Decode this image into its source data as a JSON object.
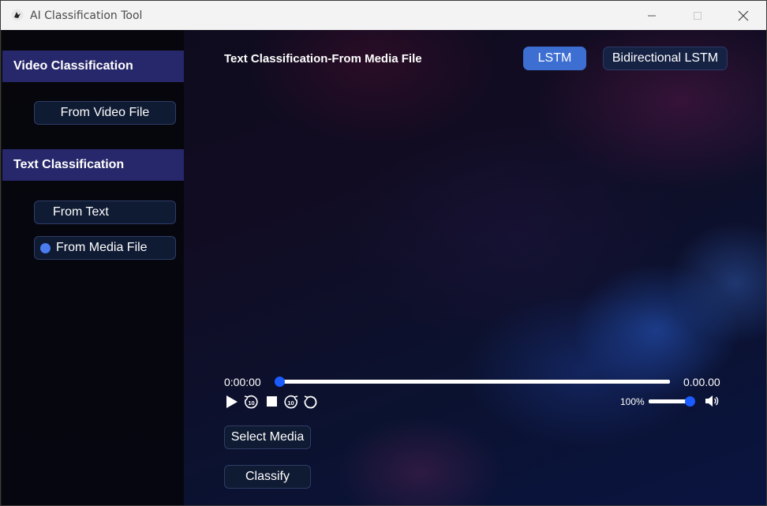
{
  "window": {
    "title": "AI Classification Tool",
    "icon": "app-bird-icon",
    "controls": [
      "minimize-icon",
      "maximize-icon",
      "close-icon"
    ]
  },
  "sidebar": {
    "video_section": {
      "header": "Video Classification",
      "items": [
        {
          "label": "From Video File",
          "selected": false
        }
      ]
    },
    "text_section": {
      "header": "Text Classification",
      "items": [
        {
          "label": "From Text",
          "selected": false
        },
        {
          "label": "From Media File",
          "selected": true
        }
      ]
    }
  },
  "main": {
    "title": "Text Classification-From Media File",
    "model_options": [
      {
        "label": "LSTM",
        "active": true
      },
      {
        "label": "Bidirectional LSTM",
        "active": false
      }
    ]
  },
  "player": {
    "time_current": "0:00:00",
    "time_total": "0.00.00",
    "progress": 0,
    "controls": [
      "play-icon",
      "rewind-10-icon",
      "stop-icon",
      "forward-10-icon",
      "replay-icon"
    ],
    "volume_label": "100%",
    "volume": 1.0,
    "speaker_icon": "speaker-icon"
  },
  "actions": {
    "select_media": "Select Media",
    "classify": "Classify"
  },
  "colors": {
    "accent_blue": "#3d6fd3",
    "slider_thumb": "#1a5cff",
    "section_header": "#27276b",
    "button_bg": "#0f1a33",
    "radio_dot": "#4a7cf0"
  }
}
